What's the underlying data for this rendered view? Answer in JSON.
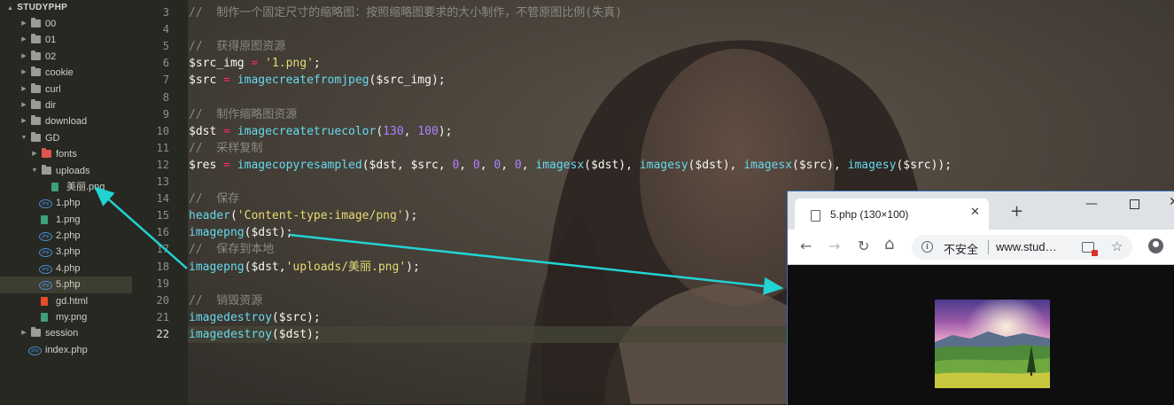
{
  "sidebar": {
    "project": "STUDYPHP",
    "items": [
      {
        "label": "00",
        "type": "folder",
        "indent": 1,
        "expanded": false
      },
      {
        "label": "01",
        "type": "folder",
        "indent": 1,
        "expanded": false
      },
      {
        "label": "02",
        "type": "folder",
        "indent": 1,
        "expanded": false
      },
      {
        "label": "cookie",
        "type": "folder",
        "indent": 1,
        "expanded": false
      },
      {
        "label": "curl",
        "type": "folder",
        "indent": 1,
        "expanded": false
      },
      {
        "label": "dir",
        "type": "folder",
        "indent": 1,
        "expanded": false
      },
      {
        "label": "download",
        "type": "folder",
        "indent": 1,
        "expanded": false
      },
      {
        "label": "GD",
        "type": "folder",
        "indent": 1,
        "expanded": true
      },
      {
        "label": "fonts",
        "type": "folder-red",
        "indent": 2,
        "expanded": false
      },
      {
        "label": "uploads",
        "type": "folder",
        "indent": 2,
        "expanded": true
      },
      {
        "label": "美丽.png",
        "type": "image",
        "indent": 3
      },
      {
        "label": "1.php",
        "type": "php",
        "indent": 2
      },
      {
        "label": "1.png",
        "type": "image",
        "indent": 2
      },
      {
        "label": "2.php",
        "type": "php",
        "indent": 2
      },
      {
        "label": "3.php",
        "type": "php",
        "indent": 2
      },
      {
        "label": "4.php",
        "type": "php",
        "indent": 2
      },
      {
        "label": "5.php",
        "type": "php",
        "indent": 2,
        "active": true
      },
      {
        "label": "gd.html",
        "type": "html",
        "indent": 2
      },
      {
        "label": "my.png",
        "type": "image",
        "indent": 2
      },
      {
        "label": "session",
        "type": "folder",
        "indent": 1,
        "expanded": false
      },
      {
        "label": "index.php",
        "type": "php",
        "indent": 1
      }
    ]
  },
  "editor": {
    "current_line": 22,
    "lines": [
      {
        "n": 3,
        "tokens": [
          [
            "cm",
            "//  制作一个固定尺寸的缩略图：按照缩略图要求的大小制作，不管原图比例(失真)"
          ]
        ]
      },
      {
        "n": 4,
        "tokens": []
      },
      {
        "n": 5,
        "tokens": [
          [
            "cm",
            "//  获得原图资源"
          ]
        ]
      },
      {
        "n": 6,
        "tokens": [
          [
            "var",
            "$src_img"
          ],
          [
            "txt",
            " "
          ],
          [
            "op",
            "="
          ],
          [
            "txt",
            " "
          ],
          [
            "str",
            "'1.png'"
          ],
          [
            "txt",
            ";"
          ]
        ]
      },
      {
        "n": 7,
        "tokens": [
          [
            "var",
            "$src"
          ],
          [
            "txt",
            " "
          ],
          [
            "op",
            "="
          ],
          [
            "txt",
            " "
          ],
          [
            "fn",
            "imagecreatefromjpeg"
          ],
          [
            "txt",
            "($src_img);"
          ]
        ]
      },
      {
        "n": 8,
        "tokens": []
      },
      {
        "n": 9,
        "tokens": [
          [
            "cm",
            "//  制作缩略图资源"
          ]
        ]
      },
      {
        "n": 10,
        "tokens": [
          [
            "var",
            "$dst"
          ],
          [
            "txt",
            " "
          ],
          [
            "op",
            "="
          ],
          [
            "txt",
            " "
          ],
          [
            "fn",
            "imagecreatetruecolor"
          ],
          [
            "txt",
            "("
          ],
          [
            "num",
            "130"
          ],
          [
            "txt",
            ", "
          ],
          [
            "num",
            "100"
          ],
          [
            "txt",
            ");"
          ]
        ]
      },
      {
        "n": 11,
        "tokens": [
          [
            "cm",
            "//  采样复制"
          ]
        ]
      },
      {
        "n": 12,
        "tokens": [
          [
            "var",
            "$res"
          ],
          [
            "txt",
            " "
          ],
          [
            "op",
            "="
          ],
          [
            "txt",
            " "
          ],
          [
            "fn",
            "imagecopyresampled"
          ],
          [
            "txt",
            "($dst, $src, "
          ],
          [
            "num",
            "0"
          ],
          [
            "txt",
            ", "
          ],
          [
            "num",
            "0"
          ],
          [
            "txt",
            ", "
          ],
          [
            "num",
            "0"
          ],
          [
            "txt",
            ", "
          ],
          [
            "num",
            "0"
          ],
          [
            "txt",
            ", "
          ],
          [
            "fn",
            "imagesx"
          ],
          [
            "txt",
            "($dst), "
          ],
          [
            "fn",
            "imagesy"
          ],
          [
            "txt",
            "($dst), "
          ],
          [
            "fn",
            "imagesx"
          ],
          [
            "txt",
            "($src), "
          ],
          [
            "fn",
            "imagesy"
          ],
          [
            "txt",
            "($src));"
          ]
        ]
      },
      {
        "n": 13,
        "tokens": []
      },
      {
        "n": 14,
        "tokens": [
          [
            "cm",
            "//  保存"
          ]
        ]
      },
      {
        "n": 15,
        "tokens": [
          [
            "fn",
            "header"
          ],
          [
            "txt",
            "("
          ],
          [
            "str",
            "'Content-type:image/png'"
          ],
          [
            "txt",
            ");"
          ]
        ]
      },
      {
        "n": 16,
        "tokens": [
          [
            "fn",
            "imagepng"
          ],
          [
            "txt",
            "($dst);"
          ]
        ]
      },
      {
        "n": 17,
        "tokens": [
          [
            "cm",
            "//  保存到本地"
          ]
        ]
      },
      {
        "n": 18,
        "tokens": [
          [
            "fn",
            "imagepng"
          ],
          [
            "txt",
            "($dst,"
          ],
          [
            "str",
            "'uploads/美丽.png'"
          ],
          [
            "txt",
            ");"
          ]
        ]
      },
      {
        "n": 19,
        "tokens": []
      },
      {
        "n": 20,
        "tokens": [
          [
            "cm",
            "//  销毁资源"
          ]
        ]
      },
      {
        "n": 21,
        "tokens": [
          [
            "fn",
            "imagedestroy"
          ],
          [
            "txt",
            "($src);"
          ]
        ]
      },
      {
        "n": 22,
        "tokens": [
          [
            "fn",
            "imagedestroy"
          ],
          [
            "txt",
            "($dst);"
          ]
        ]
      }
    ]
  },
  "browser": {
    "tab_title": "5.php (130×100)",
    "tab_close": "✕",
    "new_tab": "+",
    "minimize": "—",
    "close": "✕",
    "back": "←",
    "forward": "→",
    "reload": "↻",
    "home": "⌂",
    "info": "i",
    "security_label": "不安全",
    "url": "www.stud…",
    "star": "☆"
  },
  "icons": [
    "folder-icon",
    "php-file-icon",
    "image-file-icon",
    "html-file-icon",
    "document-icon",
    "info-icon",
    "star-icon",
    "account-icon",
    "popup-blocked-icon"
  ],
  "colors": {
    "arrow": "#22d3d3",
    "comment": "#8a8a80",
    "string": "#e6db74",
    "function": "#66d9ef",
    "number": "#ae81ff",
    "operator": "#f92672"
  }
}
